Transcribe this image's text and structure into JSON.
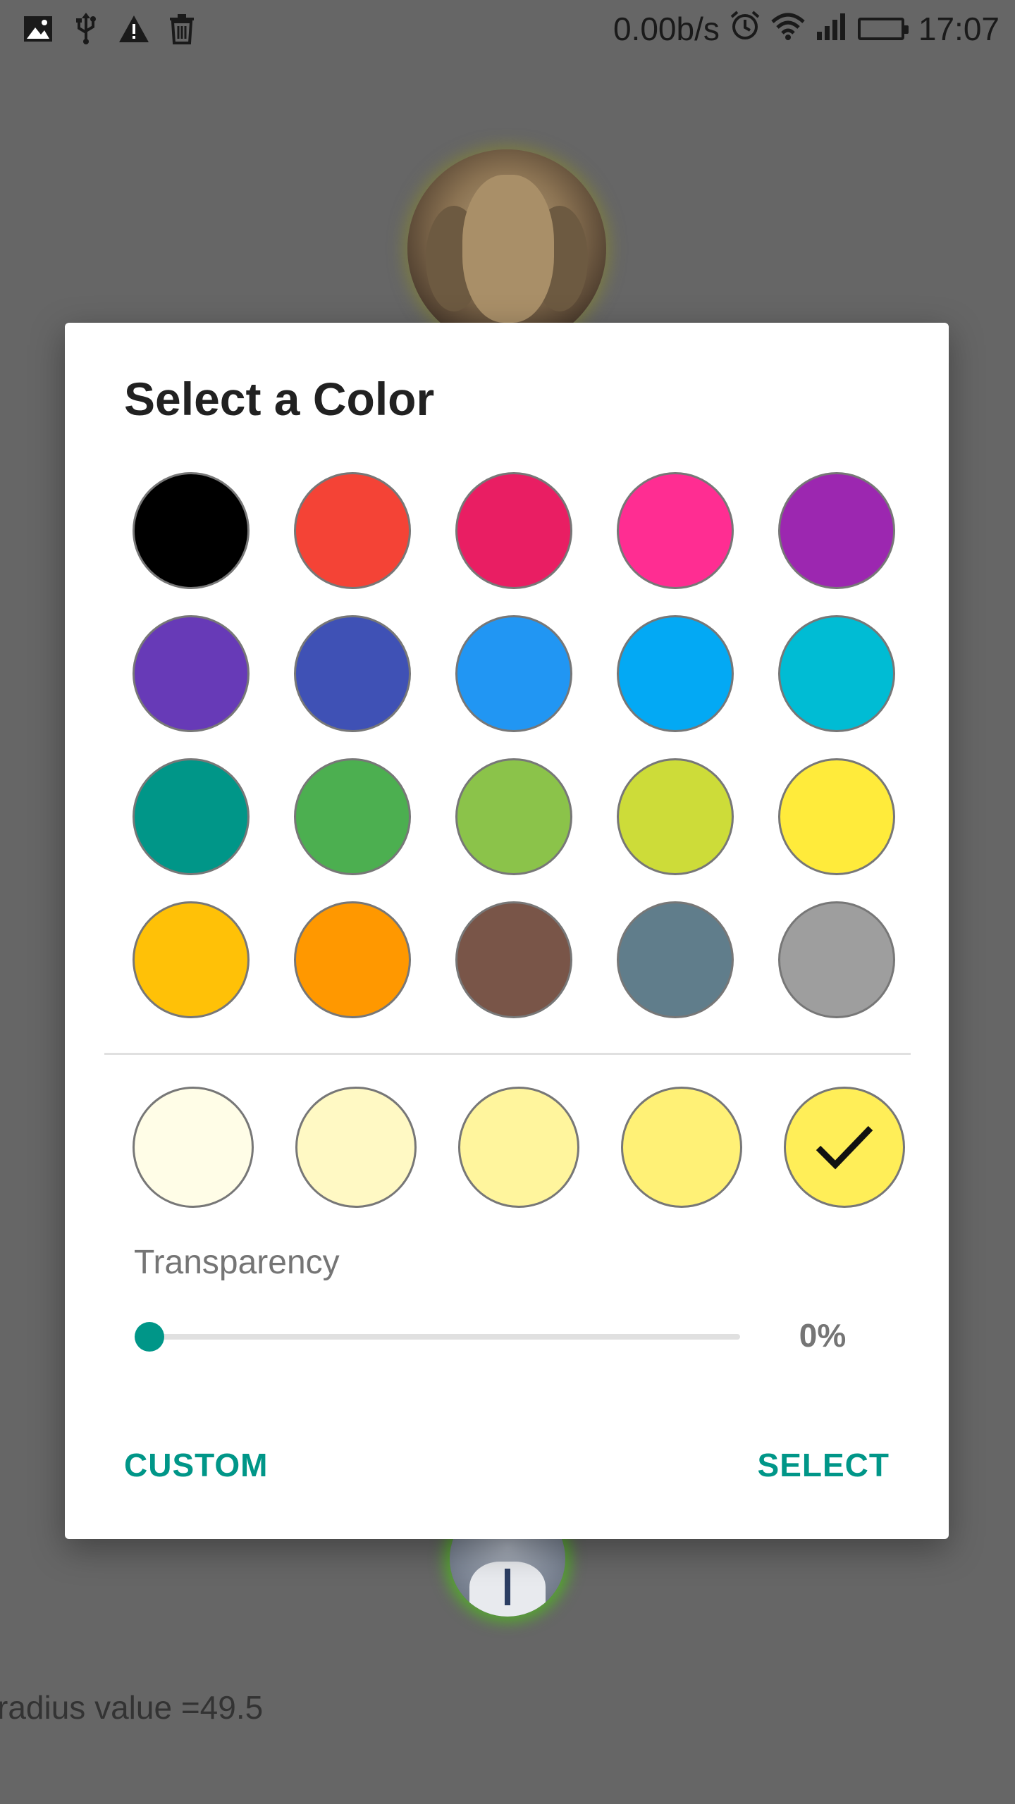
{
  "status_bar": {
    "left_icons": [
      "image-icon",
      "usb-icon",
      "warning-icon",
      "trash-icon"
    ],
    "net_speed": "0.00b/s",
    "right_icons": [
      "alarm-icon",
      "wifi-icon",
      "signal-icon",
      "battery-icon"
    ],
    "battery_color": "#22cc22",
    "time": "17:07"
  },
  "background": {
    "radius_text": "radius value =49.5",
    "avatar_glow_top": "#8c8c28",
    "avatar_glow_bottom": "#50be1e"
  },
  "dialog": {
    "title": "Select a Color",
    "palette": [
      {
        "name": "black",
        "color": "#000000"
      },
      {
        "name": "red",
        "color": "#F44336"
      },
      {
        "name": "pink",
        "color": "#E91E63"
      },
      {
        "name": "hot-pink",
        "color": "#FF2D92"
      },
      {
        "name": "purple",
        "color": "#9C27B0"
      },
      {
        "name": "deep-purple",
        "color": "#673AB7"
      },
      {
        "name": "indigo",
        "color": "#3F51B5"
      },
      {
        "name": "blue",
        "color": "#2196F3"
      },
      {
        "name": "light-blue",
        "color": "#03A9F4"
      },
      {
        "name": "cyan",
        "color": "#00BCD4"
      },
      {
        "name": "teal",
        "color": "#009688"
      },
      {
        "name": "green",
        "color": "#4CAF50"
      },
      {
        "name": "light-green",
        "color": "#8BC34A"
      },
      {
        "name": "lime",
        "color": "#CDDC39"
      },
      {
        "name": "yellow",
        "color": "#FFEB3B"
      },
      {
        "name": "amber",
        "color": "#FFC107"
      },
      {
        "name": "orange",
        "color": "#FF9800"
      },
      {
        "name": "brown",
        "color": "#795548"
      },
      {
        "name": "blue-grey",
        "color": "#607D8B"
      },
      {
        "name": "grey",
        "color": "#9E9E9E"
      }
    ],
    "shades": [
      {
        "color": "#FFFDE7",
        "selected": false
      },
      {
        "color": "#FFF9C4",
        "selected": false
      },
      {
        "color": "#FFF59D",
        "selected": false
      },
      {
        "color": "#FFF176",
        "selected": false
      },
      {
        "color": "#FFEE58",
        "selected": true
      }
    ],
    "transparency_label": "Transparency",
    "transparency_value": 0,
    "transparency_text": "0%",
    "accent_color": "#009688",
    "custom_label": "CUSTOM",
    "select_label": "SELECT"
  }
}
